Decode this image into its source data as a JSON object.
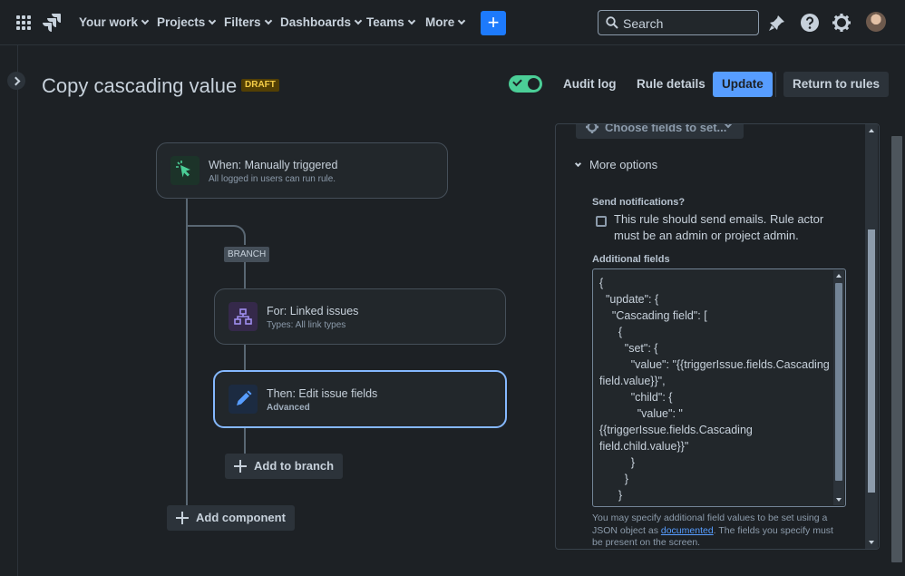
{
  "nav": {
    "items": [
      {
        "label": "Your work"
      },
      {
        "label": "Projects"
      },
      {
        "label": "Filters"
      },
      {
        "label": "Dashboards"
      },
      {
        "label": "Teams"
      },
      {
        "label": "More"
      }
    ],
    "create_label": "+",
    "search_placeholder": "Search",
    "icons": [
      "app-switcher-icon",
      "jira-logo-icon",
      "notifications-icon",
      "help-icon",
      "settings-icon",
      "avatar"
    ]
  },
  "header": {
    "title": "Copy cascading value",
    "status": "DRAFT",
    "rule_enabled": true,
    "audit_log": "Audit log",
    "rule_details": "Rule details",
    "update": "Update",
    "return_to_rules": "Return to rules"
  },
  "flow": {
    "trigger": {
      "title": "When: Manually triggered",
      "subtitle": "All logged in users can run rule."
    },
    "branch_tag": "BRANCH",
    "branch": {
      "title": "For: Linked issues",
      "subtitle": "Types: All link types"
    },
    "action": {
      "title": "Then: Edit issue fields",
      "subtitle": "Advanced"
    },
    "add_to_branch": "Add to branch",
    "add_component": "Add component"
  },
  "panel": {
    "choose_fields": "Choose fields to set...",
    "more_options": "More options",
    "send_notifications_label": "Send notifications?",
    "send_notifications_text": "This rule should send emails. Rule actor must be an admin or project admin.",
    "send_notifications_checked": false,
    "additional_fields_label": "Additional fields",
    "additional_fields_value": "{\n  \"update\": {\n    \"Cascading field\": [\n      {\n        \"set\": {\n          \"value\": \"{{triggerIssue.fields.Cascading field.value}}\",\n          \"child\": {\n            \"value\": \"\n{{triggerIssue.fields.Cascading field.child.value}}\"\n          }\n        }\n      }\n    }\n  }",
    "helper_before": "You may specify additional field values to be set using a JSON object as ",
    "helper_link": "documented",
    "helper_after": ". The fields you specify must be present on the screen."
  },
  "colors": {
    "background": "#1d2125",
    "accent": "#579dff",
    "create": "#1d7afc",
    "toggle_on": "#4bce97",
    "draft_bg": "#533f04",
    "draft_text": "#f5cd47",
    "selected_border": "#85b8ff"
  }
}
